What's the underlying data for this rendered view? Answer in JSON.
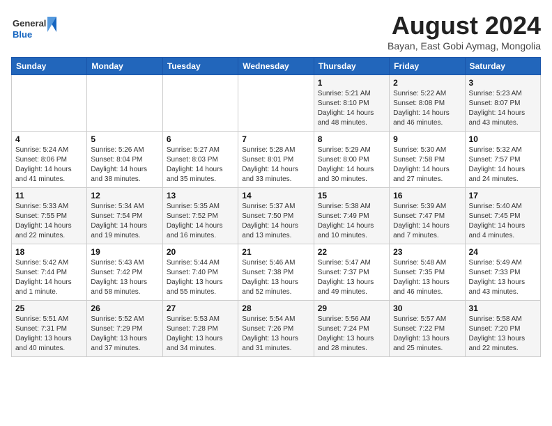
{
  "logo": {
    "general": "General",
    "blue": "Blue"
  },
  "calendar": {
    "title": "August 2024",
    "subtitle": "Bayan, East Gobi Aymag, Mongolia",
    "days_of_week": [
      "Sunday",
      "Monday",
      "Tuesday",
      "Wednesday",
      "Thursday",
      "Friday",
      "Saturday"
    ],
    "weeks": [
      [
        {
          "day": "",
          "info": ""
        },
        {
          "day": "",
          "info": ""
        },
        {
          "day": "",
          "info": ""
        },
        {
          "day": "",
          "info": ""
        },
        {
          "day": "1",
          "info": "Sunrise: 5:21 AM\nSunset: 8:10 PM\nDaylight: 14 hours\nand 48 minutes."
        },
        {
          "day": "2",
          "info": "Sunrise: 5:22 AM\nSunset: 8:08 PM\nDaylight: 14 hours\nand 46 minutes."
        },
        {
          "day": "3",
          "info": "Sunrise: 5:23 AM\nSunset: 8:07 PM\nDaylight: 14 hours\nand 43 minutes."
        }
      ],
      [
        {
          "day": "4",
          "info": "Sunrise: 5:24 AM\nSunset: 8:06 PM\nDaylight: 14 hours\nand 41 minutes."
        },
        {
          "day": "5",
          "info": "Sunrise: 5:26 AM\nSunset: 8:04 PM\nDaylight: 14 hours\nand 38 minutes."
        },
        {
          "day": "6",
          "info": "Sunrise: 5:27 AM\nSunset: 8:03 PM\nDaylight: 14 hours\nand 35 minutes."
        },
        {
          "day": "7",
          "info": "Sunrise: 5:28 AM\nSunset: 8:01 PM\nDaylight: 14 hours\nand 33 minutes."
        },
        {
          "day": "8",
          "info": "Sunrise: 5:29 AM\nSunset: 8:00 PM\nDaylight: 14 hours\nand 30 minutes."
        },
        {
          "day": "9",
          "info": "Sunrise: 5:30 AM\nSunset: 7:58 PM\nDaylight: 14 hours\nand 27 minutes."
        },
        {
          "day": "10",
          "info": "Sunrise: 5:32 AM\nSunset: 7:57 PM\nDaylight: 14 hours\nand 24 minutes."
        }
      ],
      [
        {
          "day": "11",
          "info": "Sunrise: 5:33 AM\nSunset: 7:55 PM\nDaylight: 14 hours\nand 22 minutes."
        },
        {
          "day": "12",
          "info": "Sunrise: 5:34 AM\nSunset: 7:54 PM\nDaylight: 14 hours\nand 19 minutes."
        },
        {
          "day": "13",
          "info": "Sunrise: 5:35 AM\nSunset: 7:52 PM\nDaylight: 14 hours\nand 16 minutes."
        },
        {
          "day": "14",
          "info": "Sunrise: 5:37 AM\nSunset: 7:50 PM\nDaylight: 14 hours\nand 13 minutes."
        },
        {
          "day": "15",
          "info": "Sunrise: 5:38 AM\nSunset: 7:49 PM\nDaylight: 14 hours\nand 10 minutes."
        },
        {
          "day": "16",
          "info": "Sunrise: 5:39 AM\nSunset: 7:47 PM\nDaylight: 14 hours\nand 7 minutes."
        },
        {
          "day": "17",
          "info": "Sunrise: 5:40 AM\nSunset: 7:45 PM\nDaylight: 14 hours\nand 4 minutes."
        }
      ],
      [
        {
          "day": "18",
          "info": "Sunrise: 5:42 AM\nSunset: 7:44 PM\nDaylight: 14 hours\nand 1 minute."
        },
        {
          "day": "19",
          "info": "Sunrise: 5:43 AM\nSunset: 7:42 PM\nDaylight: 13 hours\nand 58 minutes."
        },
        {
          "day": "20",
          "info": "Sunrise: 5:44 AM\nSunset: 7:40 PM\nDaylight: 13 hours\nand 55 minutes."
        },
        {
          "day": "21",
          "info": "Sunrise: 5:46 AM\nSunset: 7:38 PM\nDaylight: 13 hours\nand 52 minutes."
        },
        {
          "day": "22",
          "info": "Sunrise: 5:47 AM\nSunset: 7:37 PM\nDaylight: 13 hours\nand 49 minutes."
        },
        {
          "day": "23",
          "info": "Sunrise: 5:48 AM\nSunset: 7:35 PM\nDaylight: 13 hours\nand 46 minutes."
        },
        {
          "day": "24",
          "info": "Sunrise: 5:49 AM\nSunset: 7:33 PM\nDaylight: 13 hours\nand 43 minutes."
        }
      ],
      [
        {
          "day": "25",
          "info": "Sunrise: 5:51 AM\nSunset: 7:31 PM\nDaylight: 13 hours\nand 40 minutes."
        },
        {
          "day": "26",
          "info": "Sunrise: 5:52 AM\nSunset: 7:29 PM\nDaylight: 13 hours\nand 37 minutes."
        },
        {
          "day": "27",
          "info": "Sunrise: 5:53 AM\nSunset: 7:28 PM\nDaylight: 13 hours\nand 34 minutes."
        },
        {
          "day": "28",
          "info": "Sunrise: 5:54 AM\nSunset: 7:26 PM\nDaylight: 13 hours\nand 31 minutes."
        },
        {
          "day": "29",
          "info": "Sunrise: 5:56 AM\nSunset: 7:24 PM\nDaylight: 13 hours\nand 28 minutes."
        },
        {
          "day": "30",
          "info": "Sunrise: 5:57 AM\nSunset: 7:22 PM\nDaylight: 13 hours\nand 25 minutes."
        },
        {
          "day": "31",
          "info": "Sunrise: 5:58 AM\nSunset: 7:20 PM\nDaylight: 13 hours\nand 22 minutes."
        }
      ]
    ]
  }
}
